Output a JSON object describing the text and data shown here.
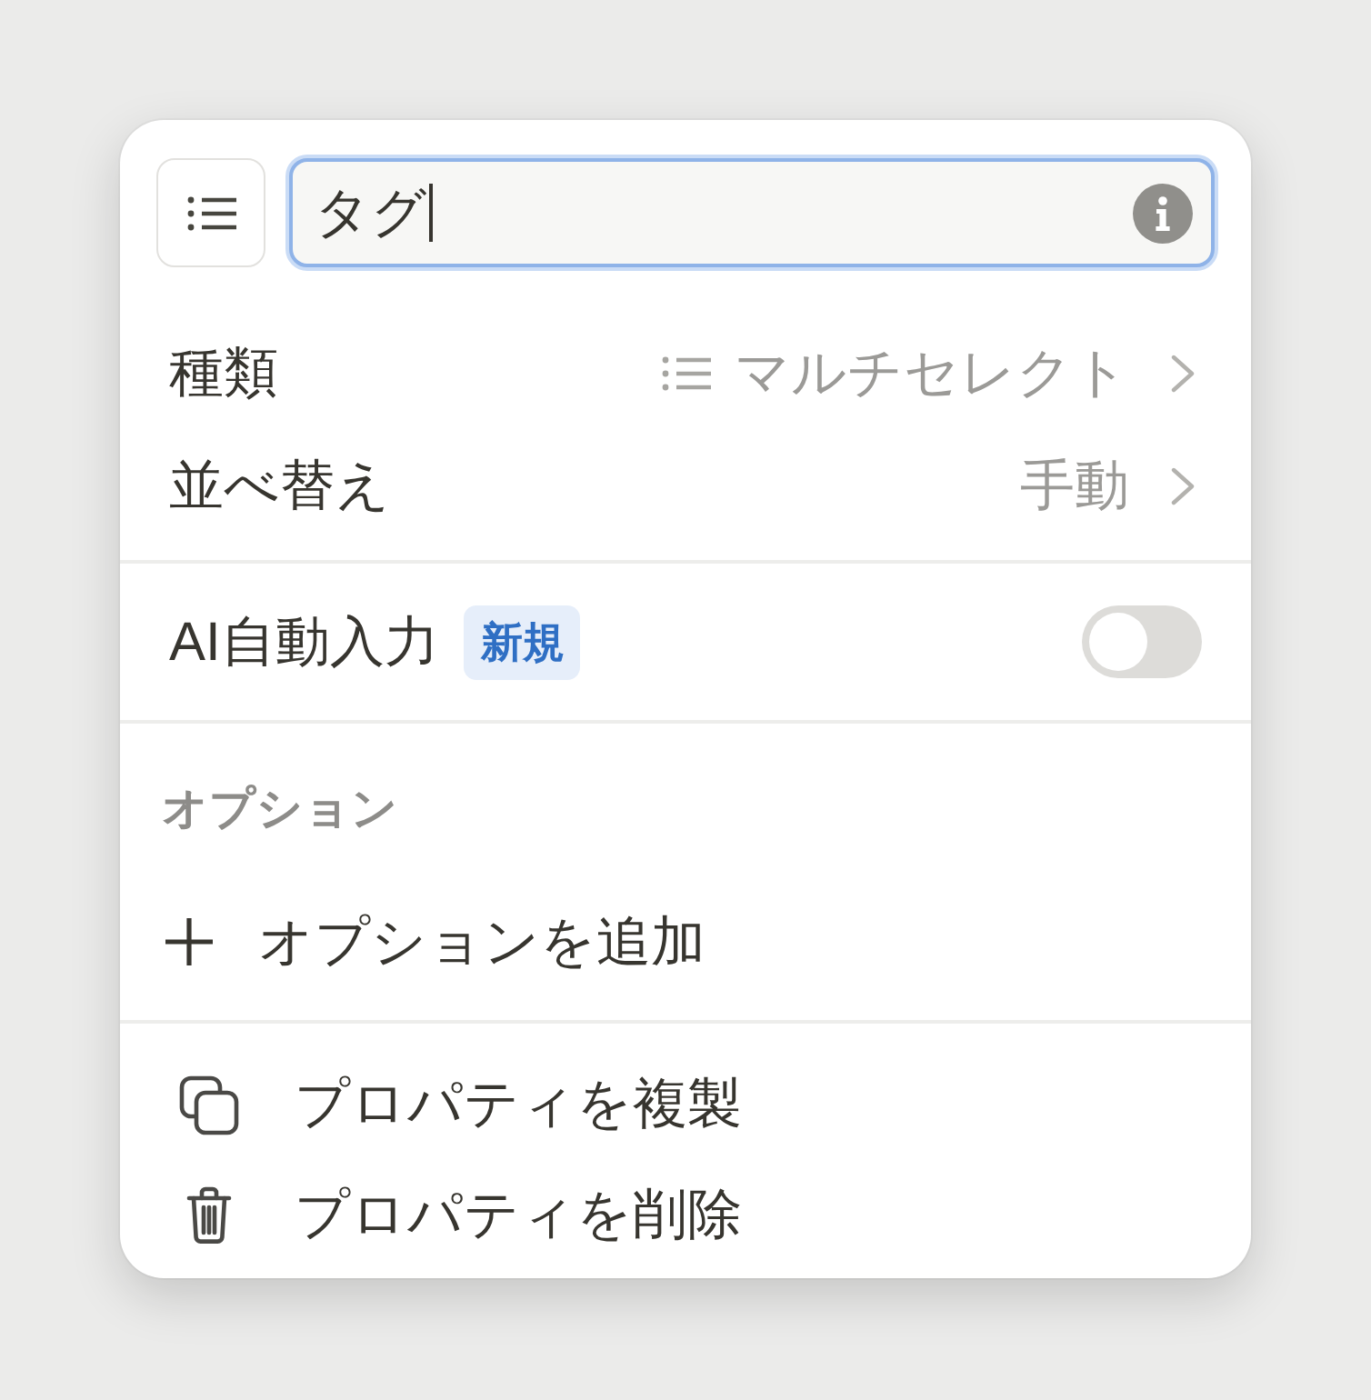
{
  "header": {
    "name_field": {
      "value": "タグ",
      "focused": true
    }
  },
  "settings": [
    {
      "kind": "type",
      "label": "種類",
      "value": "マルチセレクト"
    },
    {
      "kind": "sort",
      "label": "並べ替え",
      "value": "手動"
    }
  ],
  "ai_autofill": {
    "label": "AI自動入力",
    "badge": "新規",
    "on": false
  },
  "options": {
    "heading": "オプション",
    "add_button": "オプションを追加"
  },
  "actions": [
    {
      "kind": "duplicate",
      "label": "プロパティを複製"
    },
    {
      "kind": "delete",
      "label": "プロパティを削除"
    }
  ]
}
